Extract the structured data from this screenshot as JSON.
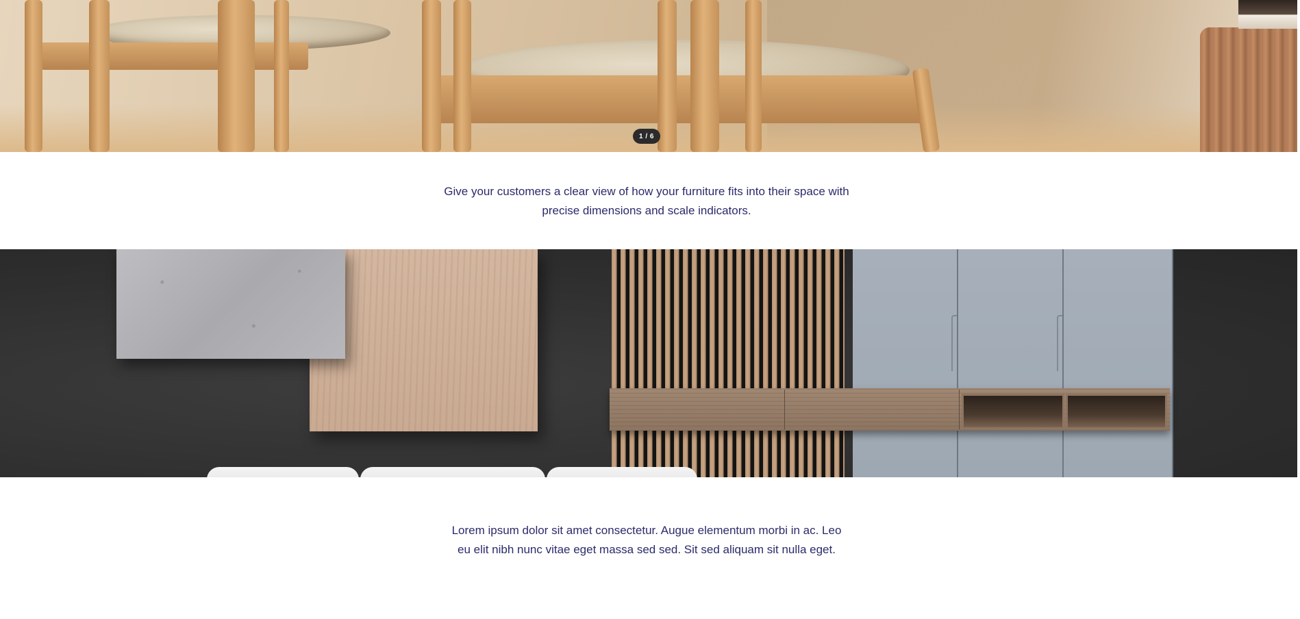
{
  "hero": {
    "slide_counter": "1 / 6"
  },
  "intro": {
    "text": "Give your customers a clear view of how your furniture fits into their space with precise dimensions and scale indicators."
  },
  "materials_section": {
    "description": "Lorem ipsum dolor sit amet consectetur. Augue elementum morbi in ac. Leo eu elit nibh nunc vitae eget massa sed sed. Sit sed aliquam sit nulla eget."
  },
  "colors": {
    "text": "#2b2a6b",
    "badge_bg": "#2b2b2b",
    "panel_bg": "#2e2e2e"
  }
}
